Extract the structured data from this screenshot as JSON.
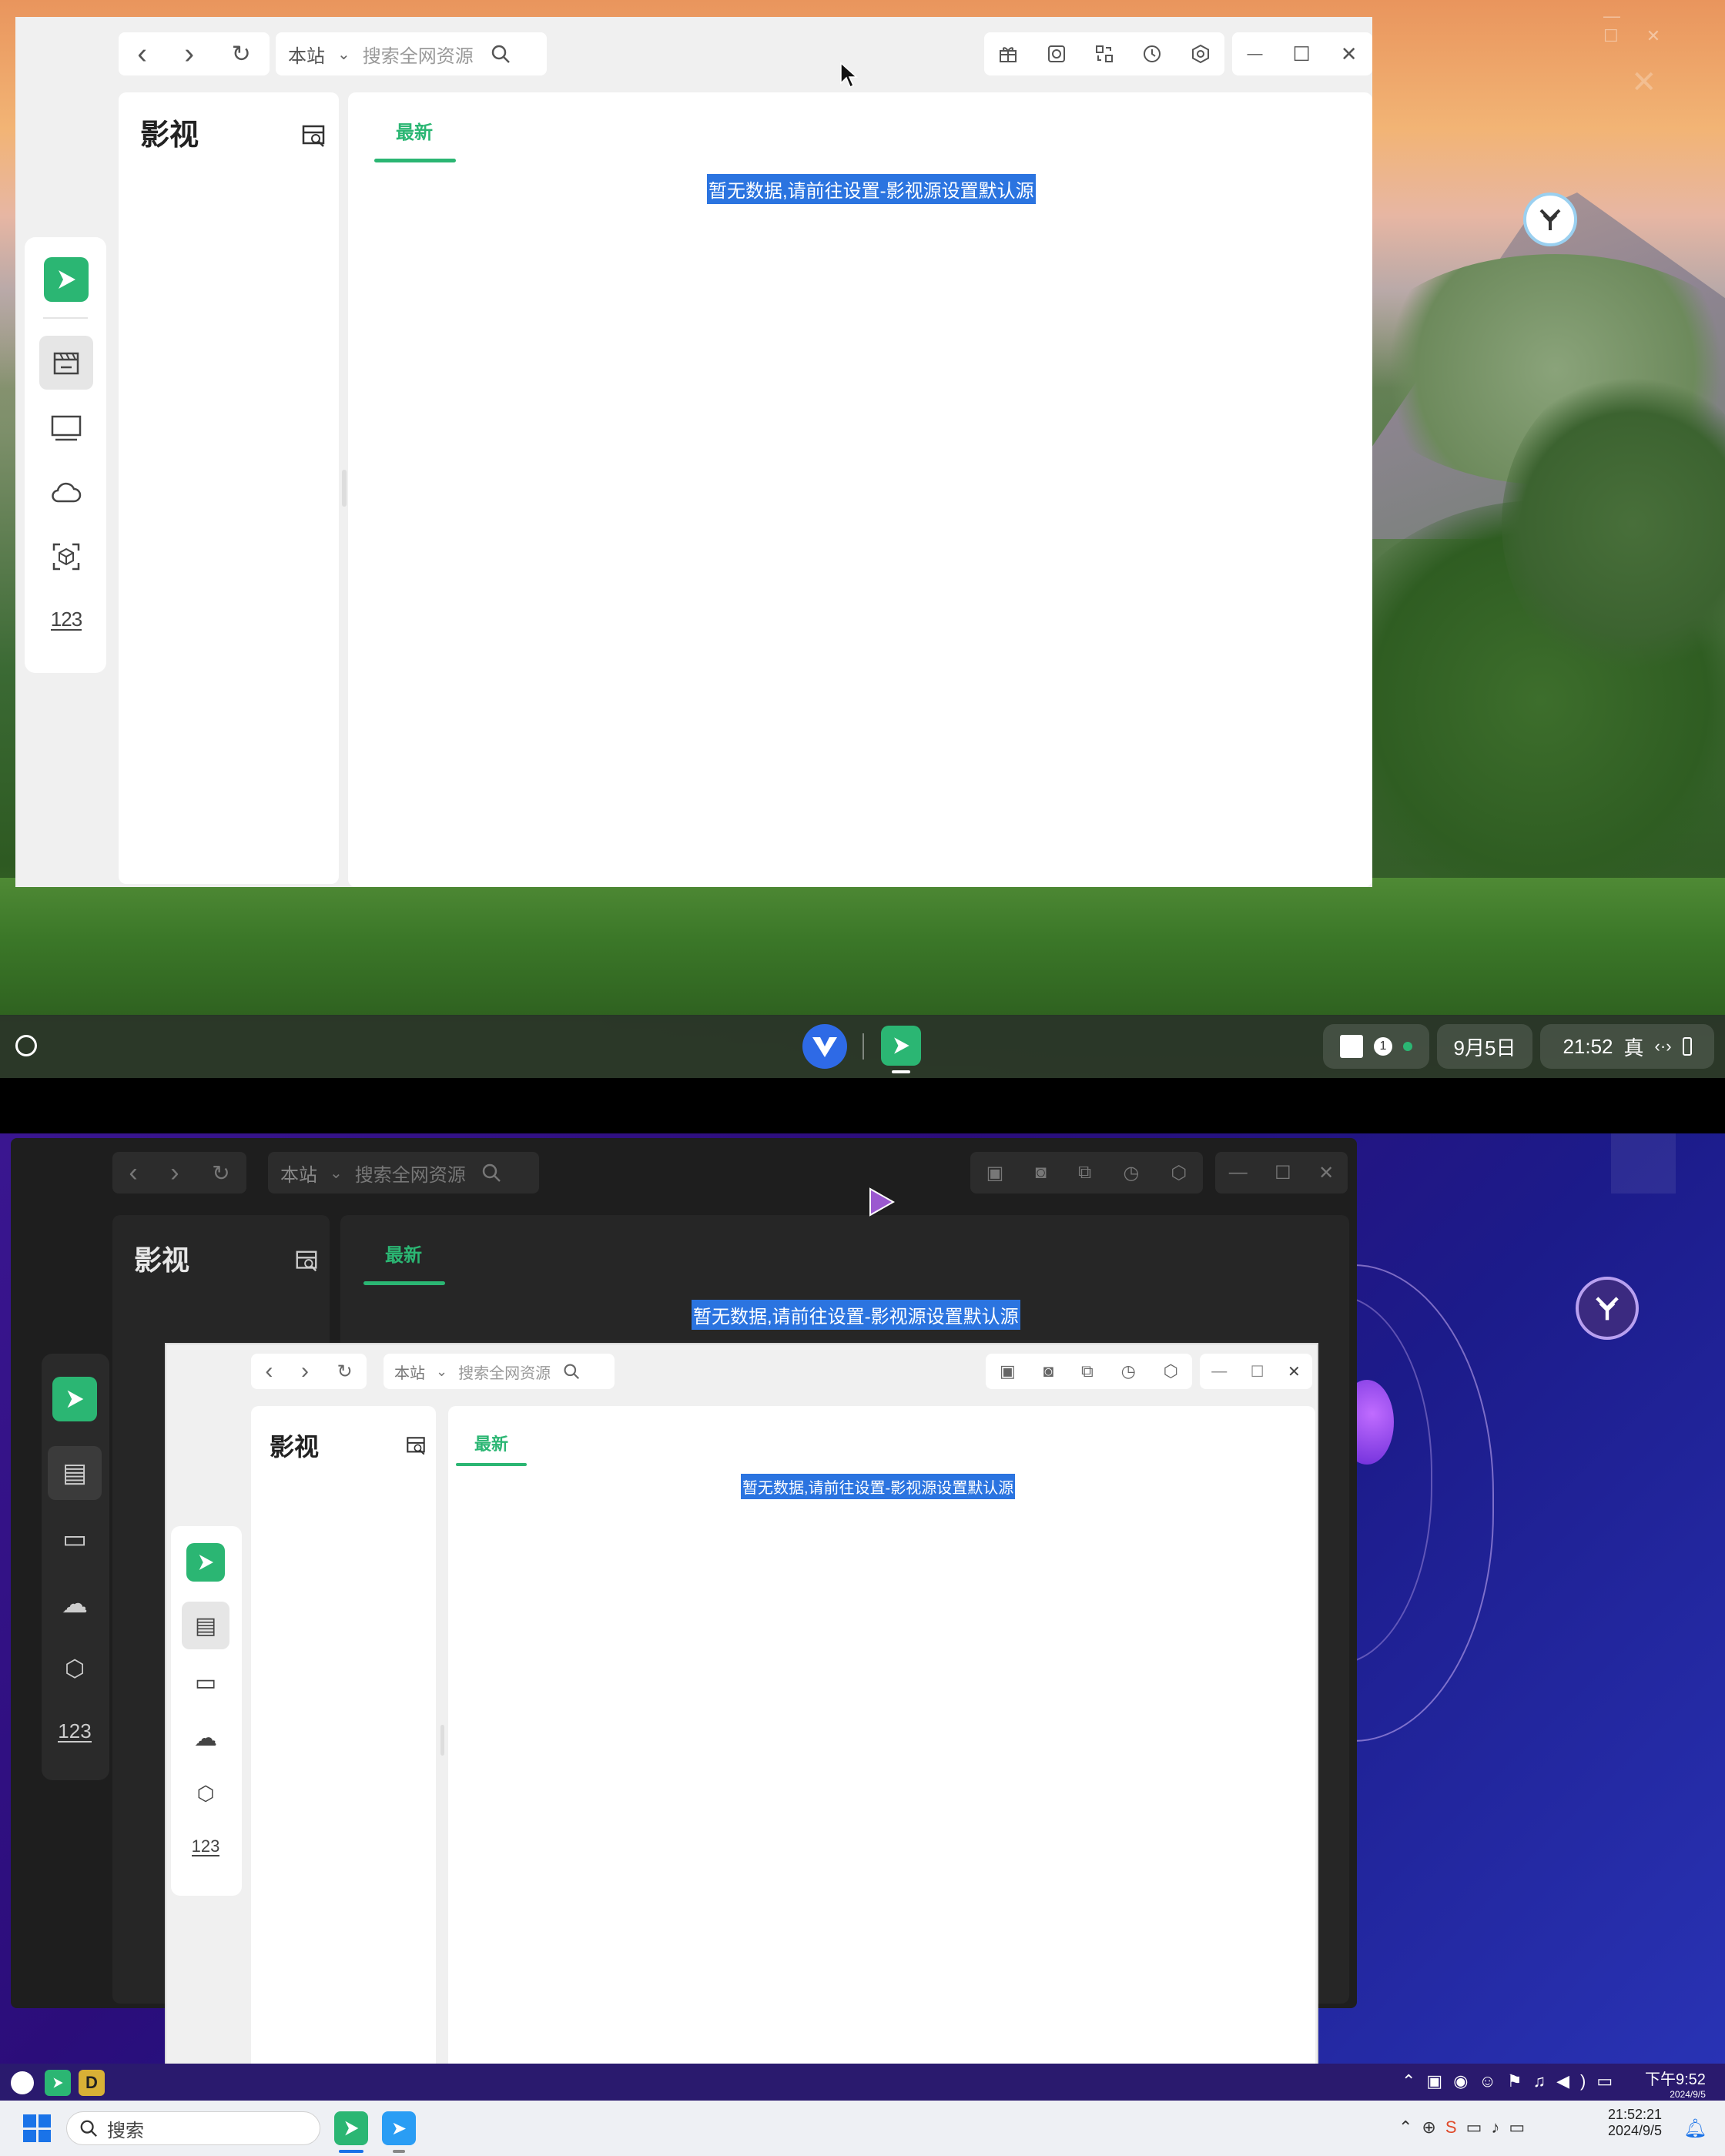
{
  "top_window": {
    "nav": {
      "back": "‹",
      "forward": "›",
      "refresh": "↻"
    },
    "search": {
      "site": "本站",
      "placeholder": "搜索全网资源"
    },
    "window_controls": {
      "minimize": "—",
      "maximize": "☐",
      "close": "✕"
    },
    "sidebar": {
      "title": "影视"
    },
    "tabs": [
      {
        "label": "最新"
      }
    ],
    "notice": "暂无数据,请前往设置-影视源设置默认源",
    "rail_items": [
      "film-icon",
      "tv-icon",
      "cloud-icon",
      "box-icon",
      "number-icon"
    ],
    "rail_number_label": "123"
  },
  "top_taskbar": {
    "date": "9月5日",
    "time": "21:52",
    "ime": "真",
    "badge": "1"
  },
  "dark_window": {
    "search": {
      "site": "本站",
      "placeholder": "搜索全网资源"
    },
    "sidebar": {
      "title": "影视"
    },
    "tabs": [
      {
        "label": "最新"
      }
    ],
    "notice": "暂无数据,请前往设置-影视源设置默认源",
    "rail_number_label": "123"
  },
  "inner_window": {
    "search": {
      "site": "本站",
      "placeholder": "搜索全网资源"
    },
    "sidebar": {
      "title": "影视"
    },
    "tabs": [
      {
        "label": "最新"
      }
    ],
    "notice": "暂无数据,请前往设置-影视源设置默认源",
    "rail_number_label": "123"
  },
  "win_taskbar": {
    "search_placeholder": "搜索",
    "time": "21:52:21",
    "date": "2024/9/5",
    "tray_time": "下午9:52",
    "tray_date": "2024/9/5"
  },
  "colors": {
    "accent": "#2bb673",
    "selection": "#2b74e0"
  }
}
